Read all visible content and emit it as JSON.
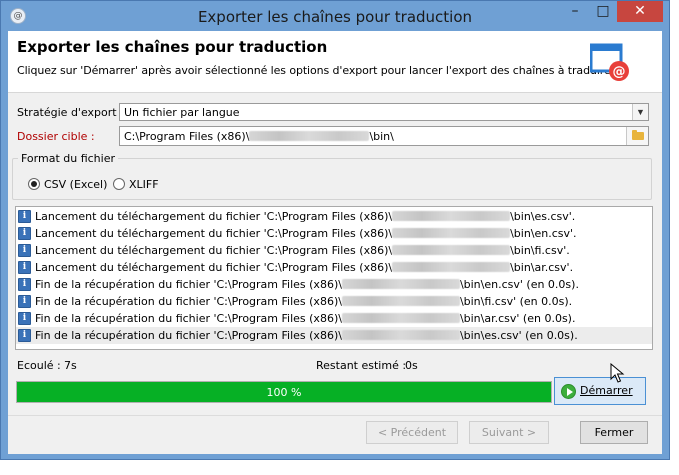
{
  "window": {
    "title": "Exporter les chaînes pour traduction",
    "minimize_glyph": "–",
    "maximize_glyph": "□",
    "close_glyph": "✕"
  },
  "header": {
    "title": "Exporter les chaînes pour traduction",
    "description": "Cliquez sur 'Démarrer' après avoir sélectionné les options d'export pour lancer l'export des chaînes à traduire.",
    "icon": "mail-export-icon"
  },
  "form": {
    "strategy_label": "Stratégie d'export :",
    "strategy_value": "Un fichier par langue",
    "target_label": "Dossier cible :",
    "target_prefix": "C:\\Program Files (x86)\\",
    "target_suffix": "\\bin\\",
    "format_group_label": "Format du fichier",
    "format_options": [
      {
        "label": "CSV (Excel)",
        "selected": true
      },
      {
        "label": "XLIFF",
        "selected": false
      }
    ]
  },
  "log": {
    "entries": [
      {
        "prefix": "Lancement du téléchargement du fichier 'C:\\Program Files (x86)\\",
        "suffix": "\\bin\\es.csv'."
      },
      {
        "prefix": "Lancement du téléchargement du fichier 'C:\\Program Files (x86)\\",
        "suffix": "\\bin\\en.csv'."
      },
      {
        "prefix": "Lancement du téléchargement du fichier 'C:\\Program Files (x86)\\",
        "suffix": "\\bin\\fi.csv'."
      },
      {
        "prefix": "Lancement du téléchargement du fichier 'C:\\Program Files (x86)\\",
        "suffix": "\\bin\\ar.csv'."
      },
      {
        "prefix": "Fin de la récupération du fichier 'C:\\Program Files (x86)\\",
        "suffix": "\\bin\\en.csv' (en 0.0s)."
      },
      {
        "prefix": "Fin de la récupération du fichier 'C:\\Program Files (x86)\\",
        "suffix": "\\bin\\fi.csv' (en 0.0s)."
      },
      {
        "prefix": "Fin de la récupération du fichier 'C:\\Program Files (x86)\\",
        "suffix": "\\bin\\ar.csv' (en 0.0s)."
      },
      {
        "prefix": "Fin de la récupération du fichier 'C:\\Program Files (x86)\\",
        "suffix": "\\bin\\es.csv' (en 0.0s)."
      }
    ]
  },
  "status": {
    "elapsed_label": "Ecoulé :",
    "elapsed_value": "7s",
    "remaining_label": "Restant estimé :",
    "remaining_value": "0s"
  },
  "progress": {
    "text": "100 %",
    "fraction": 1.0,
    "color": "#06b025"
  },
  "buttons": {
    "start": "Démarrer",
    "previous": "< Précédent",
    "next": "Suivant >",
    "close": "Fermer"
  }
}
